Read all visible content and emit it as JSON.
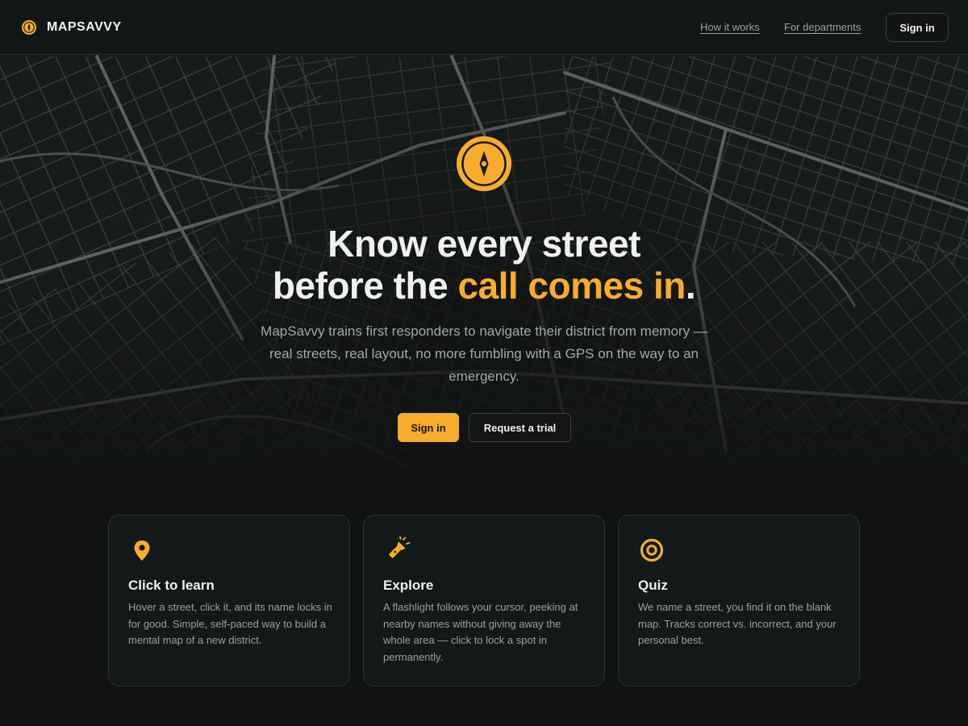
{
  "header": {
    "brand": "MAPSAVVY",
    "brand_icon": "compass-icon",
    "nav": [
      "How it works",
      "For departments"
    ],
    "signin_label": "Sign in"
  },
  "hero": {
    "logo_icon": "compass-icon",
    "headline_line1": "Know every street",
    "headline_line2_prefix": "before the ",
    "headline_accent": "call comes in",
    "headline_suffix": ".",
    "subtitle": "MapSavvy trains first responders to navigate their district from memory — real streets, real layout, no more fumbling with a GPS on the way to an emergency.",
    "primary_cta": "Sign in",
    "secondary_cta": "Request a trial"
  },
  "features": [
    {
      "icon": "map-pin-icon",
      "title": "Click to learn",
      "text": "Hover a street, click it, and its name locks in for good. Simple, self-paced way to build a mental map of a new district."
    },
    {
      "icon": "flashlight-icon",
      "title": "Explore",
      "text": "A flashlight follows your cursor, peeking at nearby names without giving away the whole area — click to lock a spot in permanently."
    },
    {
      "icon": "target-icon",
      "title": "Quiz",
      "text": "We name a street, you find it on the blank map. Tracks correct vs. incorrect, and your personal best."
    }
  ],
  "colors": {
    "accent": "#f6ac2c",
    "background": "#0f1211",
    "card": "#131918",
    "text": "#eef1ec",
    "muted": "#a2aaa5"
  }
}
